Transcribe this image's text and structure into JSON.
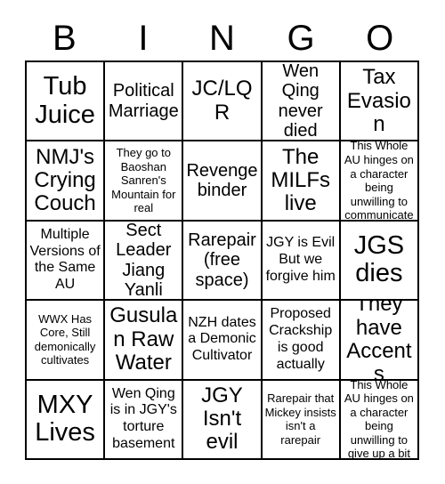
{
  "header": {
    "letters": [
      "B",
      "I",
      "N",
      "G",
      "O"
    ]
  },
  "grid": {
    "columns": 5,
    "rows": 5,
    "free_space_index": 12,
    "cells": [
      {
        "text": "Tub Juice",
        "size": "xl"
      },
      {
        "text": "Political Marriage",
        "size": "md"
      },
      {
        "text": "JC/LQR",
        "size": "lg"
      },
      {
        "text": "Wen Qing never died",
        "size": "md"
      },
      {
        "text": "Tax Evasion",
        "size": "lg"
      },
      {
        "text": "NMJ's Crying Couch",
        "size": "lg"
      },
      {
        "text": "They go to Baoshan Sanren's Mountain for real",
        "size": "xs"
      },
      {
        "text": "Revenge binder",
        "size": "md"
      },
      {
        "text": "The MILFs live",
        "size": "lg"
      },
      {
        "text": "This Whole AU hinges on a character being unwilling to communicate",
        "size": "xs"
      },
      {
        "text": "Multiple Versions of the Same AU",
        "size": "sm"
      },
      {
        "text": "Sect Leader Jiang Yanli",
        "size": "md"
      },
      {
        "text": "Rarepair (free space)",
        "size": "md"
      },
      {
        "text": "JGY is Evil But we forgive him",
        "size": "sm"
      },
      {
        "text": "JGS dies",
        "size": "xl"
      },
      {
        "text": "WWX Has Core, Still demonically cultivates",
        "size": "xs"
      },
      {
        "text": "Gusulan Raw Water",
        "size": "lg"
      },
      {
        "text": "NZH dates a Demonic Cultivator",
        "size": "sm"
      },
      {
        "text": "Proposed Crackship is good actually",
        "size": "sm"
      },
      {
        "text": "They have Accents",
        "size": "lg"
      },
      {
        "text": "MXY Lives",
        "size": "xl"
      },
      {
        "text": "Wen Qing is in JGY's torture basement",
        "size": "sm"
      },
      {
        "text": "JGY Isn't evil",
        "size": "lg"
      },
      {
        "text": "Rarepair that Mickey insists isn't a rarepair",
        "size": "xs"
      },
      {
        "text": "This Whole AU hinges on a character being unwilling to give up a bit",
        "size": "xs"
      }
    ]
  },
  "colors": {
    "background": "#ffffff",
    "text": "#000000",
    "border": "#000000"
  }
}
